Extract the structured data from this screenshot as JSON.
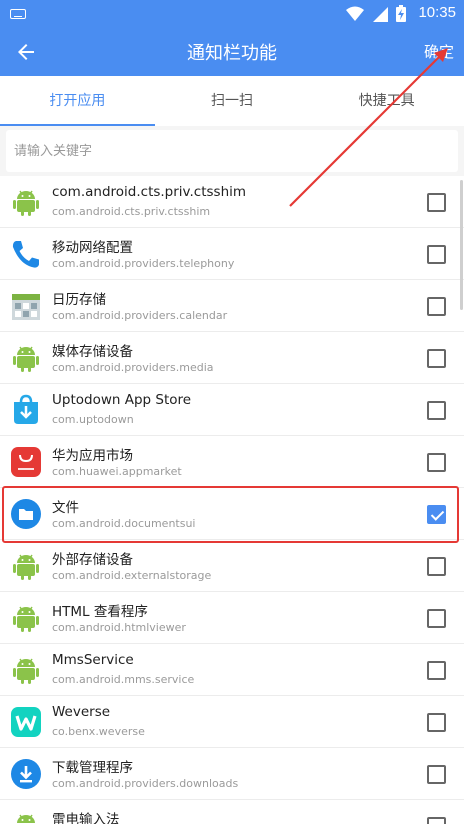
{
  "status": {
    "time": "10:35"
  },
  "appbar": {
    "title": "通知栏功能",
    "confirm_label": "确定"
  },
  "tabs": [
    {
      "label": "打开应用",
      "active": true
    },
    {
      "label": "扫一扫",
      "active": false
    },
    {
      "label": "快捷工具",
      "active": false
    }
  ],
  "search": {
    "placeholder": "请输入关键字"
  },
  "apps": [
    {
      "name": "com.android.cts.priv.ctsshim",
      "pkg": "com.android.cts.priv.ctsshim",
      "icon": "android-icon",
      "checked": false
    },
    {
      "name": "移动网络配置",
      "pkg": "com.android.providers.telephony",
      "icon": "phone-icon",
      "checked": false
    },
    {
      "name": "日历存储",
      "pkg": "com.android.providers.calendar",
      "icon": "calendar-icon",
      "checked": false
    },
    {
      "name": "媒体存储设备",
      "pkg": "com.android.providers.media",
      "icon": "android-icon",
      "checked": false
    },
    {
      "name": "Uptodown App Store",
      "pkg": "com.uptodown",
      "icon": "uptodown-icon",
      "checked": false
    },
    {
      "name": "华为应用市场",
      "pkg": "com.huawei.appmarket",
      "icon": "huawei-appmarket-icon",
      "checked": false
    },
    {
      "name": "文件",
      "pkg": "com.android.documentsui",
      "icon": "folder-icon",
      "checked": true
    },
    {
      "name": "外部存储设备",
      "pkg": "com.android.externalstorage",
      "icon": "android-icon",
      "checked": false
    },
    {
      "name": "HTML 查看程序",
      "pkg": "com.android.htmlviewer",
      "icon": "android-icon",
      "checked": false
    },
    {
      "name": "MmsService",
      "pkg": "com.android.mms.service",
      "icon": "android-icon",
      "checked": false
    },
    {
      "name": "Weverse",
      "pkg": "co.benx.weverse",
      "icon": "weverse-icon",
      "checked": false
    },
    {
      "name": "下载管理程序",
      "pkg": "com.android.providers.downloads",
      "icon": "download-icon",
      "checked": false
    },
    {
      "name": "雷电输入法",
      "pkg": "",
      "icon": "android-icon",
      "checked": false
    }
  ],
  "colors": {
    "accent": "#4a8df1",
    "highlight": "#e53935"
  }
}
